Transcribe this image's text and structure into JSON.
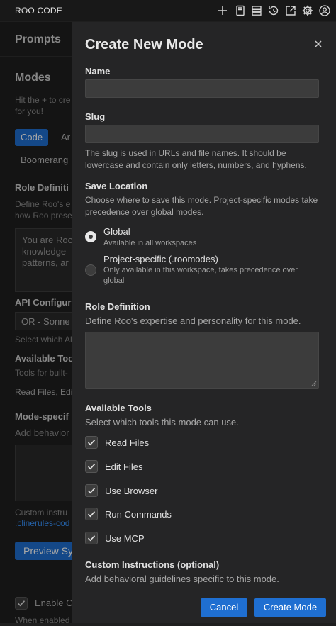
{
  "titlebar": {
    "title": "ROO CODE"
  },
  "background": {
    "prompts_heading": "Prompts",
    "modes_heading": "Modes",
    "modes_hint_1": "Hit the + to cre",
    "modes_hint_2": "for you!",
    "mode_code": "Code",
    "mode_ar": "Ar",
    "mode_boomerang": "Boomerang",
    "role_heading": "Role Definiti",
    "role_desc_1": "Define Roo's e",
    "role_desc_2": "how Roo prese",
    "role_text_1": "You are Roo",
    "role_text_2": "knowledge",
    "role_text_3": "patterns, ar",
    "api_heading": "API Configur",
    "api_select": "OR - Sonne",
    "api_hint": "Select which Al",
    "tools_heading": "Available Too",
    "tools_desc": "Tools for built-",
    "tools_list": "Read Files, Edi",
    "mode_specific_heading": "Mode-specif",
    "mode_specific_desc": "Add behavior",
    "custom_instr_1": "Custom instru",
    "custom_instr_link": ".clinerules-cod",
    "preview_btn": "Preview Sy",
    "enable_label": "Enable C",
    "enable_desc": "When enabled"
  },
  "modal": {
    "title": "Create New Mode",
    "name_label": "Name",
    "slug_label": "Slug",
    "slug_help": "The slug is used in URLs and file names. It should be lowercase and contain only letters, numbers, and hyphens.",
    "save_location_label": "Save Location",
    "save_location_desc": "Choose where to save this mode. Project-specific modes take precedence over global modes.",
    "options": [
      {
        "title": "Global",
        "desc": "Available in all workspaces",
        "selected": true
      },
      {
        "title": "Project-specific (.roomodes)",
        "desc": "Only available in this workspace, takes precedence over global",
        "selected": false
      }
    ],
    "role_label": "Role Definition",
    "role_desc": "Define Roo's expertise and personality for this mode.",
    "tools_label": "Available Tools",
    "tools_desc": "Select which tools this mode can use.",
    "tools": [
      {
        "label": "Read Files",
        "checked": true
      },
      {
        "label": "Edit Files",
        "checked": true
      },
      {
        "label": "Use Browser",
        "checked": true
      },
      {
        "label": "Run Commands",
        "checked": true
      },
      {
        "label": "Use MCP",
        "checked": true
      }
    ],
    "custom_label": "Custom Instructions (optional)",
    "custom_desc": "Add behavioral guidelines specific to this mode.",
    "cancel_label": "Cancel",
    "create_label": "Create Mode"
  },
  "colors": {
    "accent": "#1f6fd1",
    "panel": "#252526",
    "input": "#3c3c3c"
  }
}
